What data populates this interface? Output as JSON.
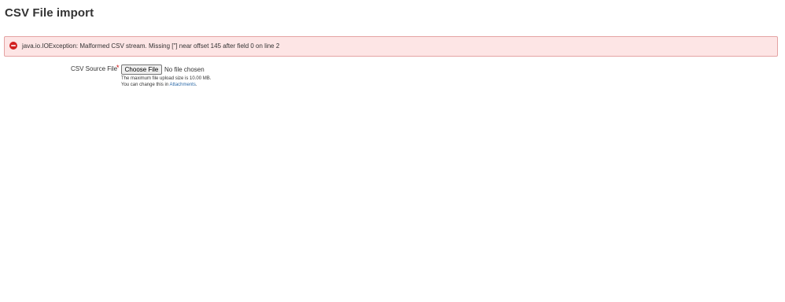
{
  "page": {
    "title": "CSV File import"
  },
  "error": {
    "icon": "error-circle-icon",
    "message": "java.io.IOException: Malformed CSV stream. Missing [\"] near offset 145 after field 0 on line 2",
    "colors": {
      "background": "#fde5e5",
      "border": "#e4a3a3",
      "icon": "#d21f1f"
    }
  },
  "form": {
    "source_file": {
      "label": "CSV Source File",
      "required_marker": "*",
      "button_label": "Choose File",
      "status": "No file chosen",
      "help_line_1": "The maximum file upload size is 10.00 MB.",
      "help_line_2_prefix": "You can change this in ",
      "help_link": "Attachments",
      "help_line_2_suffix": "."
    }
  }
}
